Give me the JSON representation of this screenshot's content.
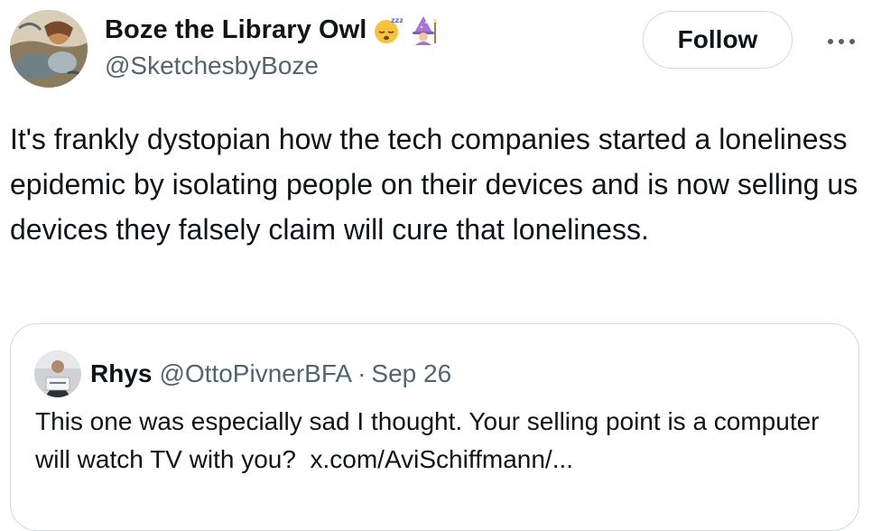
{
  "author": {
    "display_name": "Boze the Library Owl",
    "handle": "@SketchesbyBoze",
    "emojis": [
      "sleeping-face-icon",
      "woman-mage-icon"
    ]
  },
  "actions": {
    "follow_label": "Follow",
    "more_label": "···"
  },
  "tweet": {
    "text": "It's frankly dystopian how the tech companies started a loneliness epidemic by isolating people on their devices and is now selling us devices they falsely claim will cure that loneliness."
  },
  "quoted_tweet": {
    "display_name": "Rhys",
    "handle": "@OttoPivnerBFA",
    "separator": "·",
    "date": "Sep 26",
    "text": "This one was especially sad I thought. Your selling point is a computer will watch TV with you?",
    "link": "x.com/AviSchiffmann/..."
  },
  "colors": {
    "text_primary": "#0f1419",
    "text_secondary": "#536471",
    "border": "#cfd9de"
  }
}
